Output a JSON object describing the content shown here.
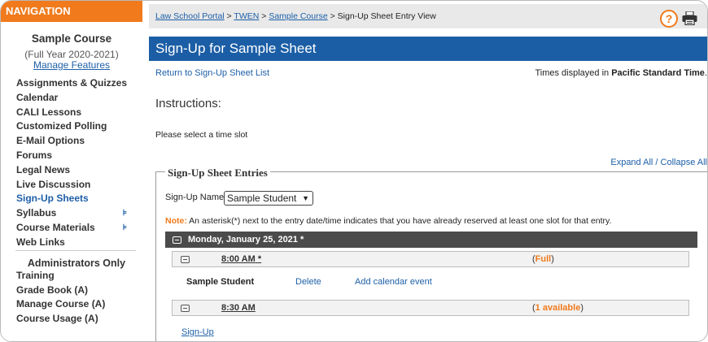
{
  "sidebar": {
    "header": "NAVIGATION",
    "course_title": "Sample Course",
    "course_term": "(Full Year 2020-2021)",
    "manage_features": "Manage Features",
    "items": [
      {
        "label": "Assignments & Quizzes"
      },
      {
        "label": "Calendar"
      },
      {
        "label": "CALI Lessons"
      },
      {
        "label": "Customized Polling"
      },
      {
        "label": "E-Mail Options"
      },
      {
        "label": "Forums"
      },
      {
        "label": "Legal News"
      },
      {
        "label": "Live Discussion"
      },
      {
        "label": "Sign-Up Sheets",
        "active": true
      },
      {
        "label": "Syllabus",
        "icon": "tree-icon"
      },
      {
        "label": "Course Materials",
        "icon": "tree-icon"
      },
      {
        "label": "Web Links"
      }
    ],
    "admin_title": "Administrators Only",
    "admin_items": [
      {
        "label": "Training"
      },
      {
        "label": "Grade Book (A)"
      },
      {
        "label": "Manage Course (A)"
      },
      {
        "label": "Course Usage (A)"
      }
    ]
  },
  "topbar": {
    "crumbs": [
      "Law School Portal",
      "TWEN",
      "Sample Course"
    ],
    "current": "Sign-Up Sheet Entry View",
    "separator": " > ",
    "help_icon": "help-icon",
    "print_icon": "printer-icon",
    "help_glyph": "?"
  },
  "main": {
    "title": "Sign-Up for Sample Sheet",
    "return_link": "Return to Sign-Up Sheet List",
    "tz_prefix": "Times displayed in ",
    "tz_name": "Pacific Standard Time",
    "tz_suffix": ".",
    "instructions_head": "Instructions:",
    "instructions_text": "Please select a time slot",
    "expand_collapse": "Expand All / Collapse All"
  },
  "entries": {
    "legend": "Sign-Up Sheet Entries",
    "signup_name_label": "Sign-Up Name:",
    "signup_name_value": "Sample Student",
    "note_label": "Note:",
    "note_text": " An asterisk(*) next to the entry date/time indicates that you have already reserved at least one slot for that entry.",
    "day": {
      "label": "Monday, January 25, 2021 *"
    },
    "slots": [
      {
        "time": "8:00 AM",
        "star": " *",
        "status": "Full"
      },
      {
        "time": "8:30 AM",
        "star": "",
        "status": "1 available"
      }
    ],
    "attendee": {
      "name": "Sample Student",
      "delete": "Delete",
      "calendar": "Add calendar event"
    },
    "signup_link": "Sign-Up"
  },
  "colors": {
    "accent": "#f07a1c",
    "brand": "#1b5ea6",
    "link": "#1d5fa8",
    "day_bar": "#4b4b4b"
  }
}
